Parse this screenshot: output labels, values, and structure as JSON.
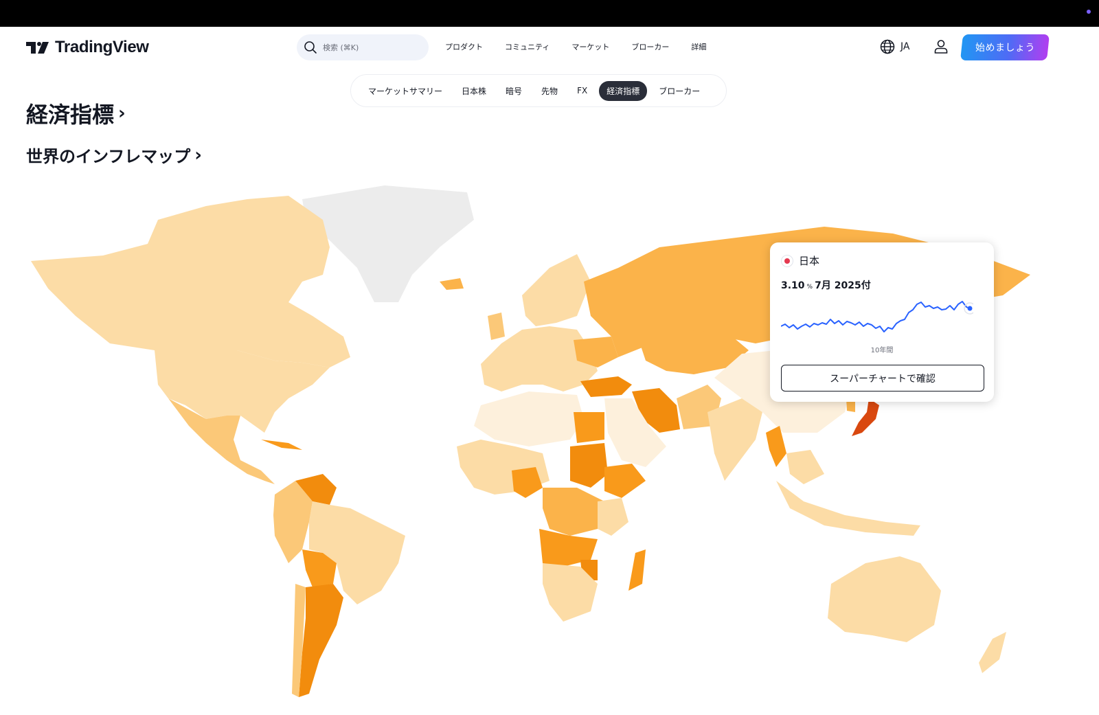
{
  "header": {
    "brand": "TradingView",
    "search_placeholder": "検索 (⌘K)",
    "nav": [
      "プロダクト",
      "コミュニティ",
      "マーケット",
      "ブローカー",
      "詳細"
    ],
    "language": "JA",
    "cta": "始めましょう"
  },
  "subnav": {
    "items": [
      "マーケットサマリー",
      "日本株",
      "暗号",
      "先物",
      "FX",
      "経済指標",
      "ブローカー"
    ],
    "active": "経済指標"
  },
  "page": {
    "title": "経済指標",
    "section_title": "世界のインフレマップ"
  },
  "tooltip": {
    "country": "日本",
    "value": "3.10",
    "unit": "%",
    "date": "7月 2025付",
    "period": "10年間",
    "button": "スーパーチャートで確認"
  },
  "colors": {
    "accent": "#2962ff",
    "scale_lightest": "#fdf0dc",
    "scale_light": "#fcdca6",
    "scale_mid": "#fbc878",
    "scale_high": "#fbb34a",
    "scale_higher": "#f99a1b",
    "scale_highest": "#f28c0d",
    "extreme": "#d9480f",
    "no_data": "#ececec"
  }
}
